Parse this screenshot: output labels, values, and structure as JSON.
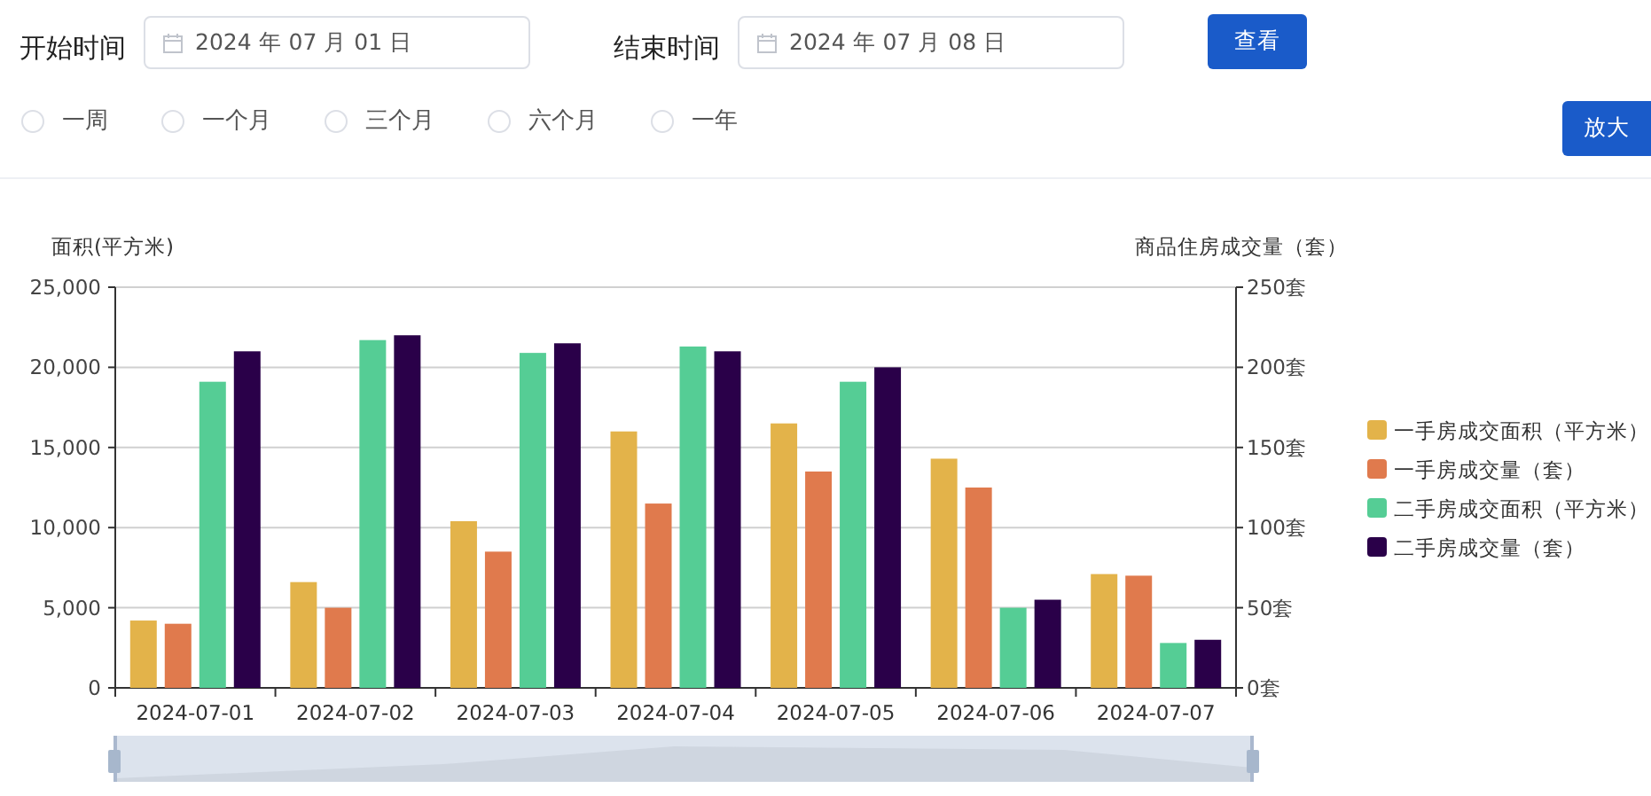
{
  "filters": [
    {
      "label": "开始时间",
      "value": "2024 年 07 月 01 日"
    },
    {
      "label": "结束时间",
      "value": "2024 年 07 月 08 日"
    }
  ],
  "query_button": "查看",
  "ranges": [
    {
      "label": "一周",
      "selected": false
    },
    {
      "label": "一个月",
      "selected": false
    },
    {
      "label": "三个月",
      "selected": false
    },
    {
      "label": "六个月",
      "selected": false
    },
    {
      "label": "一年",
      "selected": false
    }
  ],
  "zoom_button": "放大",
  "chart": {
    "chart_data": {
      "type": "bar",
      "ylabel": "面积(平方米)",
      "y2label": "商品住房成交量（套）",
      "categories": [
        "2024-07-01",
        "2024-07-02",
        "2024-07-03",
        "2024-07-04",
        "2024-07-05",
        "2024-07-06",
        "2024-07-07"
      ],
      "ylim": [
        0,
        25000
      ],
      "y2lim": [
        0,
        250
      ],
      "yticks": [
        {
          "value": 0,
          "label": "0"
        },
        {
          "value": 5000,
          "label": "5,000"
        },
        {
          "value": 10000,
          "label": "10,000"
        },
        {
          "value": 15000,
          "label": "15,000"
        },
        {
          "value": 20000,
          "label": "20,000"
        },
        {
          "value": 25000,
          "label": "25,000"
        }
      ],
      "y2ticks": [
        {
          "value": 0,
          "label": "0套"
        },
        {
          "value": 50,
          "label": "50套"
        },
        {
          "value": 100,
          "label": "100套"
        },
        {
          "value": 150,
          "label": "150套"
        },
        {
          "value": 200,
          "label": "200套"
        },
        {
          "value": 250,
          "label": "250套"
        }
      ],
      "stacked": false,
      "grid": true,
      "legend": "right",
      "series": [
        {
          "name": "一手房成交面积（平方米）",
          "color": "#e3b34a",
          "values": [
            4200,
            6600,
            10400,
            16000,
            16500,
            14300,
            7100
          ]
        },
        {
          "name": "一手房成交量（套）",
          "color": "#e07a4d",
          "axis": "y2",
          "values": [
            40,
            50,
            85,
            115,
            135,
            125,
            70
          ]
        },
        {
          "name": "二手房成交面积（平方米）",
          "color": "#55cd95",
          "values": [
            19100,
            21700,
            20900,
            21300,
            19100,
            5000,
            2800
          ]
        },
        {
          "name": "二手房成交量（套）",
          "color": "#2a0049",
          "axis": "y2",
          "values": [
            210,
            220,
            215,
            210,
            200,
            55,
            30
          ]
        }
      ]
    }
  }
}
